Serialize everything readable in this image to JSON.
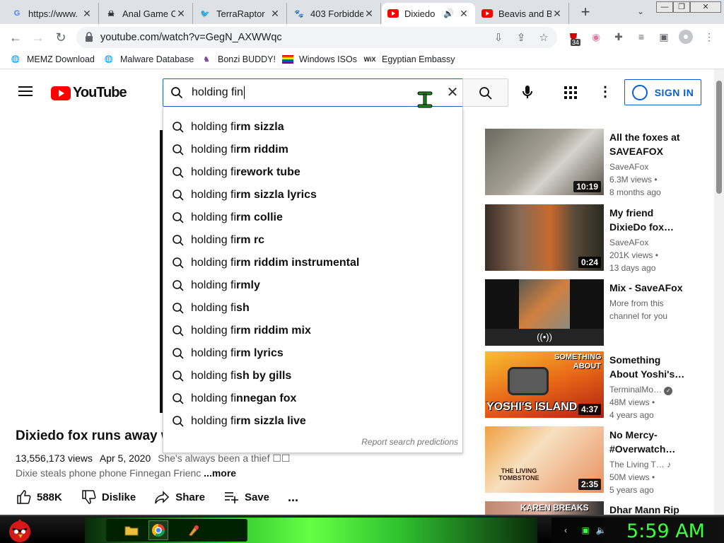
{
  "colors": {
    "accent": "#065fd4",
    "brand_red": "#ff0000",
    "clock_green": "#3cff3c"
  },
  "browser": {
    "tabs": [
      {
        "title": "https://www.",
        "icon": "google-icon"
      },
      {
        "title": "Anal Game C",
        "icon": "skull-icon"
      },
      {
        "title": "TerraRaptor",
        "icon": "twitter-icon"
      },
      {
        "title": "403 Forbidde",
        "icon": "paw-icon"
      },
      {
        "title": "Dixiedo",
        "icon": "youtube-icon",
        "active": true,
        "audio": true
      },
      {
        "title": "Beavis and B",
        "icon": "youtube-icon"
      }
    ],
    "url": "youtube.com/watch?v=GegN_AXWWqc",
    "extension_badge": "34",
    "bookmarks": [
      "MEMZ Download",
      "Malware Database",
      "Bonzi BUDDY!",
      "Windows ISOs",
      "Egyptian Embassy"
    ],
    "bookmark_icons": [
      "globe-icon",
      "globe-icon",
      "bonzi-icon",
      "rainbow-flag-icon",
      "wix-icon"
    ],
    "wix_label": "WiX"
  },
  "youtube": {
    "logo_text": "YouTube",
    "search_value": "holding fin",
    "sign_in": "SIGN IN",
    "suggestions": [
      {
        "prefix": "holding fi",
        "rest": "rm sizzla"
      },
      {
        "prefix": "holding fi",
        "rest": "rm riddim"
      },
      {
        "prefix": "holding fi",
        "rest": "rework tube"
      },
      {
        "prefix": "holding fi",
        "rest": "rm sizzla lyrics"
      },
      {
        "prefix": "holding fi",
        "rest": "rm collie"
      },
      {
        "prefix": "holding fi",
        "rest": "rm rc"
      },
      {
        "prefix": "holding fi",
        "rest": "rm riddim instrumental"
      },
      {
        "prefix": "holding fi",
        "rest": "rmly"
      },
      {
        "prefix": "holding fi",
        "rest": "sh"
      },
      {
        "prefix": "holding fi",
        "rest": "rm riddim mix"
      },
      {
        "prefix": "holding fi",
        "rest": "rm lyrics"
      },
      {
        "prefix": "holding fi",
        "rest": "sh by gills"
      },
      {
        "prefix": "holding fi",
        "rest": "nnegan fox"
      },
      {
        "prefix": "holding fi",
        "rest": "rm sizzla live"
      }
    ],
    "report_link": "Report search predictions",
    "video": {
      "title": "Dixiedo fox runs away wi",
      "views": "13,556,173 views",
      "date": "Apr 5, 2020",
      "desc_line1": "She's always been a thief ☐☐",
      "desc_line2": "Dixie steals phone phone Finnegan Frienc",
      "more": "...more",
      "likes": "588K",
      "dislike": "Dislike",
      "share": "Share",
      "save": "Save",
      "more_actions": "..."
    },
    "recommendations": [
      {
        "title": "All the foxes at SAVEAFOX ge…",
        "channel": "SaveAFox",
        "views": "6.3M views •",
        "age": "8 months ago",
        "duration": "10:19"
      },
      {
        "title": "My friend DixieDo fox…",
        "channel": "SaveAFox",
        "views": "201K views •",
        "age": "13 days ago",
        "duration": "0:24"
      },
      {
        "title": "Mix - SaveAFox",
        "channel": "More from this",
        "views": "channel for you",
        "age": "",
        "duration": ""
      },
      {
        "title": "Something About Yoshi's…",
        "channel": "TerminalMo…",
        "views": "48M views •",
        "age": "4 years ago",
        "duration": "4:37",
        "thumb_text_top": "SOMETHING ABOUT",
        "thumb_text_bottom": "YOSHI'S ISLAND"
      },
      {
        "title": "No Mercy- #Overwatch…",
        "channel": "The Living T…",
        "views": "50M views •",
        "age": "5 years ago",
        "duration": "2:35",
        "thumb_text_top": "THE LIVING TOMBSTONE"
      },
      {
        "title": "Dhar Mann Rip",
        "channel": "",
        "views": "",
        "age": "",
        "duration": "",
        "thumb_text_top": "KAREN BREAKS"
      }
    ]
  },
  "taskbar": {
    "clock": "5:59 AM"
  }
}
